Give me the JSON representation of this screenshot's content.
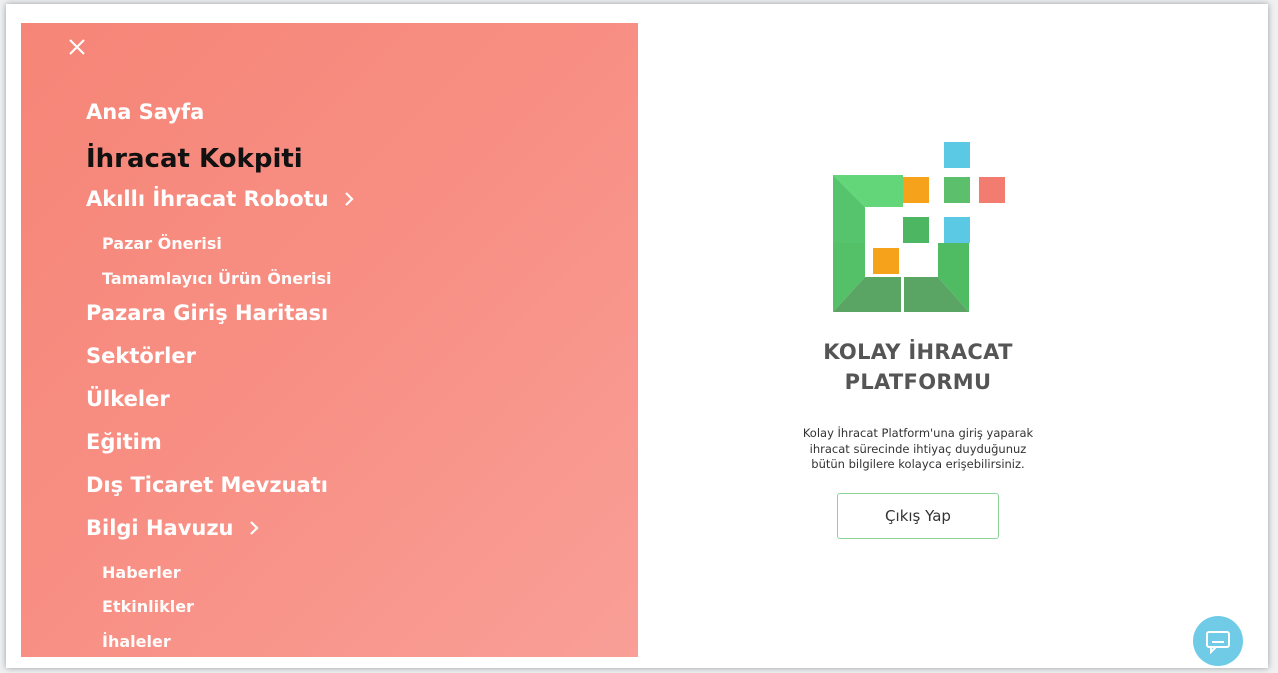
{
  "menu": {
    "close_icon": "close-icon",
    "items": [
      {
        "label": "Ana Sayfa"
      },
      {
        "label": "İhracat Kokpiti",
        "active": true
      },
      {
        "label": "Akıllı İhracat Robotu",
        "has_submenu": true
      },
      {
        "label": "Pazar Önerisi",
        "sub": true
      },
      {
        "label": "Tamamlayıcı Ürün Önerisi",
        "sub": true
      },
      {
        "label": "Pazara Giriş Haritası"
      },
      {
        "label": "Sektörler"
      },
      {
        "label": "Ülkeler"
      },
      {
        "label": "Eğitim"
      },
      {
        "label": "Dış Ticaret Mevzuatı"
      },
      {
        "label": "Bilgi Havuzu",
        "has_submenu": true
      },
      {
        "label": "Haberler",
        "sub": true
      },
      {
        "label": "Etkinlikler",
        "sub": true
      },
      {
        "label": "İhaleler",
        "sub": true
      }
    ]
  },
  "brand": {
    "title_line1": "KOLAY İHRACAT",
    "title_line2": "PLATFORMU",
    "description_line1": "Kolay İhracat Platform'una giriş yaparak",
    "description_line2": "ihracat sürecinde ihtiyaç duyduğunuz",
    "description_line3": "bütün bilgilere kolayca erişebilirsiniz.",
    "logout_label": "Çıkış Yap"
  },
  "chat": {
    "icon": "chat-icon"
  },
  "colors": {
    "menu_bg": "#f88f84",
    "active_text": "#111111",
    "logo_green": "#5bbf6b",
    "logo_orange": "#f6a21b",
    "logo_blue": "#5bc9e3",
    "logo_red": "#f27c70",
    "button_border": "#8fd39b"
  }
}
